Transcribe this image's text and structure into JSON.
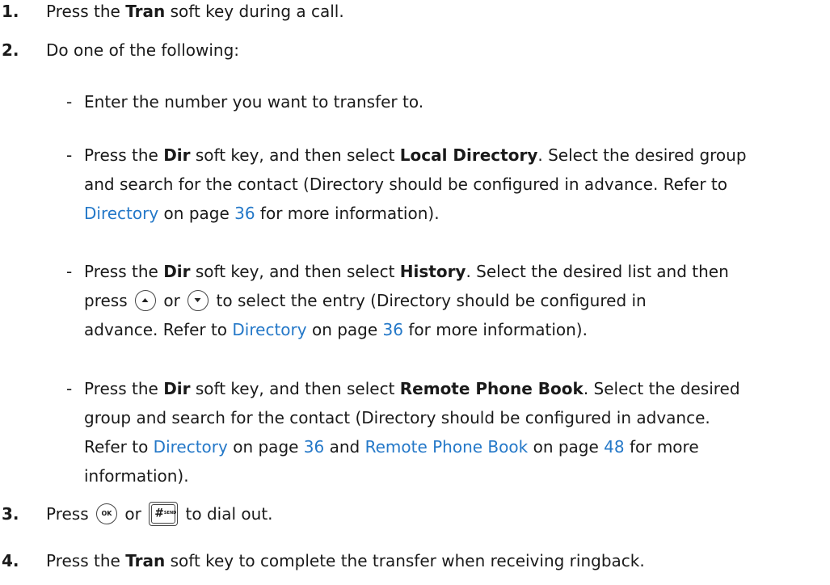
{
  "step1": {
    "num": "1.",
    "t1": "Press the ",
    "b1": "Tran",
    "t2": " soft key during a call."
  },
  "step2": {
    "num": "2.",
    "text": "Do one of the following:"
  },
  "opt1": {
    "dash": "-",
    "text": "Enter the number you want to transfer to."
  },
  "opt2": {
    "dash": "-",
    "l1_t1": "Press the ",
    "l1_b1": "Dir",
    "l1_t2": " soft key, and then select ",
    "l1_b2": "Local Directory",
    "l1_t3": ". Select the desired group",
    "l2": "and search for the contact (Directory should be configured in advance. Refer to",
    "l3_link": "Directory",
    "l3_t1": " on page ",
    "l3_page": "36",
    "l3_t2": " for more information)."
  },
  "opt3": {
    "dash": "-",
    "l1_t1": "Press the ",
    "l1_b1": "Dir",
    "l1_t2": " soft key, and then select ",
    "l1_b2": "History",
    "l1_t3": ". Select the desired list and then",
    "l2_t1": "press",
    "l2_t2": "or",
    "l2_t3": "to select the entry (Directory should be configured in",
    "l3_t1": "advance. Refer to ",
    "l3_link": "Directory",
    "l3_t2": " on page ",
    "l3_page": "36",
    "l3_t3": " for more information)."
  },
  "opt4": {
    "dash": "-",
    "l1_t1": "Press the ",
    "l1_b1": "Dir",
    "l1_t2": " soft key, and then select ",
    "l1_b2": "Remote Phone Book",
    "l1_t3": ". Select the desired",
    "l2": "group and search for the contact (Directory should be configured in advance.",
    "l3_t1": "Refer to ",
    "l3_link1": "Directory",
    "l3_t2": " on page ",
    "l3_page1": "36",
    "l3_t3": " and ",
    "l3_link2": "Remote Phone  Book",
    "l3_t4": " on page ",
    "l3_page2": "48",
    "l3_t5": " for more",
    "l4": "information)."
  },
  "step3": {
    "num": "3.",
    "t1": "Press",
    "t2": "or",
    "t3": "to dial out.",
    "ok_key": "OK",
    "send_key_hash": "#",
    "send_key_label": "SEND"
  },
  "step4": {
    "num": "4.",
    "t1": "Press the ",
    "b1": "Tran",
    "t2": " soft key to complete the transfer when receiving ringback."
  },
  "icons": {
    "up": "up-arrow-key-icon",
    "down": "down-arrow-key-icon",
    "ok": "ok-key-icon",
    "send": "send-key-icon"
  },
  "colors": {
    "link": "#2478c8",
    "text": "#1a1a1a"
  }
}
